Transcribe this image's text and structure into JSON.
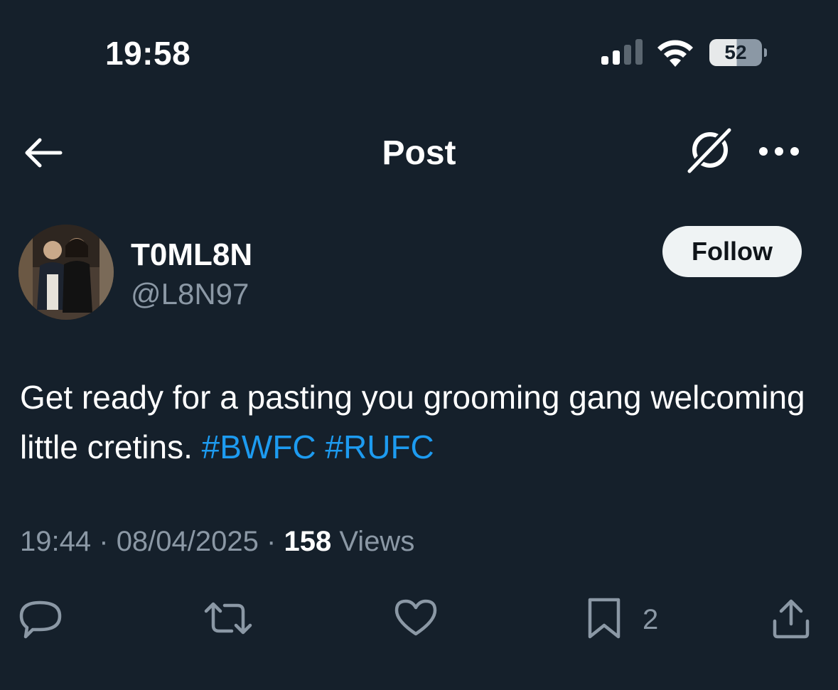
{
  "status_bar": {
    "time": "19:58",
    "battery_level": "52"
  },
  "header": {
    "title": "Post"
  },
  "post": {
    "author": {
      "display_name": "T0ML8N",
      "handle": "@L8N97"
    },
    "follow_label": "Follow",
    "text_plain": "Get ready for a pasting you grooming gang welcoming little cretins.",
    "hashtags": [
      "#BWFC",
      "#RUFC"
    ],
    "time": "19:44",
    "separator": "·",
    "date": "08/04/2025",
    "views_count": "158",
    "views_label": "Views",
    "bookmark_count": "2"
  },
  "colors": {
    "background": "#15202b",
    "accent": "#1d9bf0",
    "muted_text": "#8b98a5"
  },
  "icons": {
    "back": "arrow-left-icon",
    "grok": "grok-icon",
    "more": "more-dots-icon",
    "reply": "reply-icon",
    "repost": "repost-icon",
    "like": "heart-icon",
    "bookmark": "bookmark-icon",
    "share": "share-icon"
  }
}
